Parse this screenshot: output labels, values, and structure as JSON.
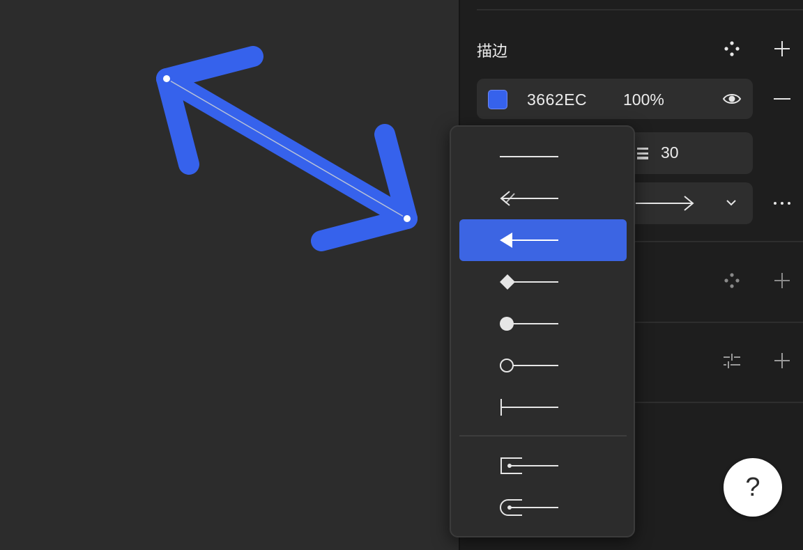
{
  "colors": {
    "accent": "#3662EC",
    "canvas_bg": "#2c2c2c",
    "panel_bg": "#1e1e1e",
    "menu_bg": "#2c2c2c",
    "menu_selected": "#3c65e3"
  },
  "stroke": {
    "title": "描边",
    "hex": "3662EC",
    "opacity": "100%",
    "weight": "30"
  },
  "help": {
    "label": "?"
  },
  "arrow_menu": {
    "items": [
      {
        "icon": "line-none-icon",
        "checked": false,
        "selected": false
      },
      {
        "icon": "line-arrow-icon",
        "checked": true,
        "selected": false
      },
      {
        "icon": "triangle-arrow-icon",
        "checked": false,
        "selected": true
      },
      {
        "icon": "diamond-icon",
        "checked": false,
        "selected": false
      },
      {
        "icon": "filled-circle-icon",
        "checked": false,
        "selected": false
      },
      {
        "icon": "open-circle-icon",
        "checked": false,
        "selected": false
      },
      {
        "icon": "bar-end-icon",
        "checked": false,
        "selected": false
      },
      {
        "icon": "square-cap-icon",
        "checked": false,
        "selected": false
      },
      {
        "icon": "round-cap-icon",
        "checked": false,
        "selected": false
      }
    ]
  }
}
